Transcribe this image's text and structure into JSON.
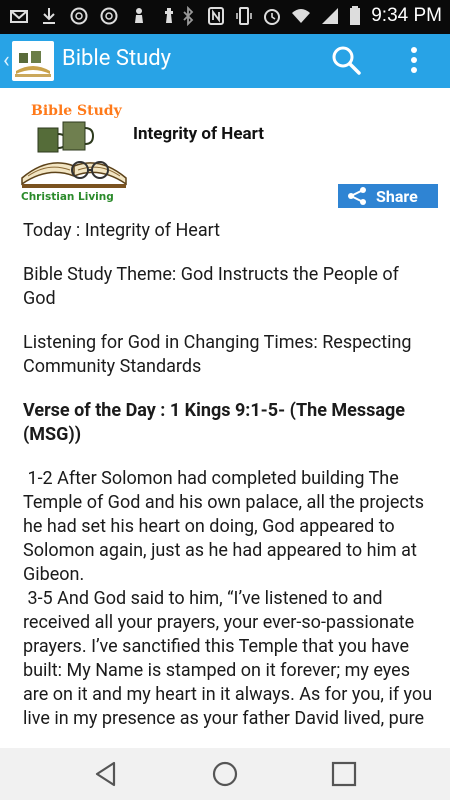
{
  "status_bar": {
    "time": "9:34 PM"
  },
  "app_bar": {
    "title": "Bible Study"
  },
  "article": {
    "logo_line1": "Bible Study",
    "logo_line2": "Christian Living",
    "heading": "Integrity of Heart",
    "share_label": "Share",
    "paragraphs": [
      "Today : Integrity of Heart",
      "Bible Study Theme: God Instructs the People of God",
      "Listening for God in Changing Times: Respecting Community Standards",
      "Verse of the Day : 1 Kings 9:1-5- (The Message (MSG))",
      " 1-2 After Solomon had completed building The Temple of God and his own palace, all the projects he had set his heart on doing, God appeared to Solomon again, just as he had appeared to him at Gibeon.\n 3-5 And God said to him, “I’ve listened to and received all your prayers, your ever-so-passionate prayers. I’ve sanctified this Temple that you have built: My Name is stamped on it forever; my eyes are on it and my heart in it always. As for you, if you live in my presence as your father David lived, pure"
    ]
  },
  "colors": {
    "app_bar": "#28a3e6",
    "share_button": "#2f84d3",
    "status_bar": "#0a0a0a",
    "nav_bar": "#f1f1f1"
  }
}
